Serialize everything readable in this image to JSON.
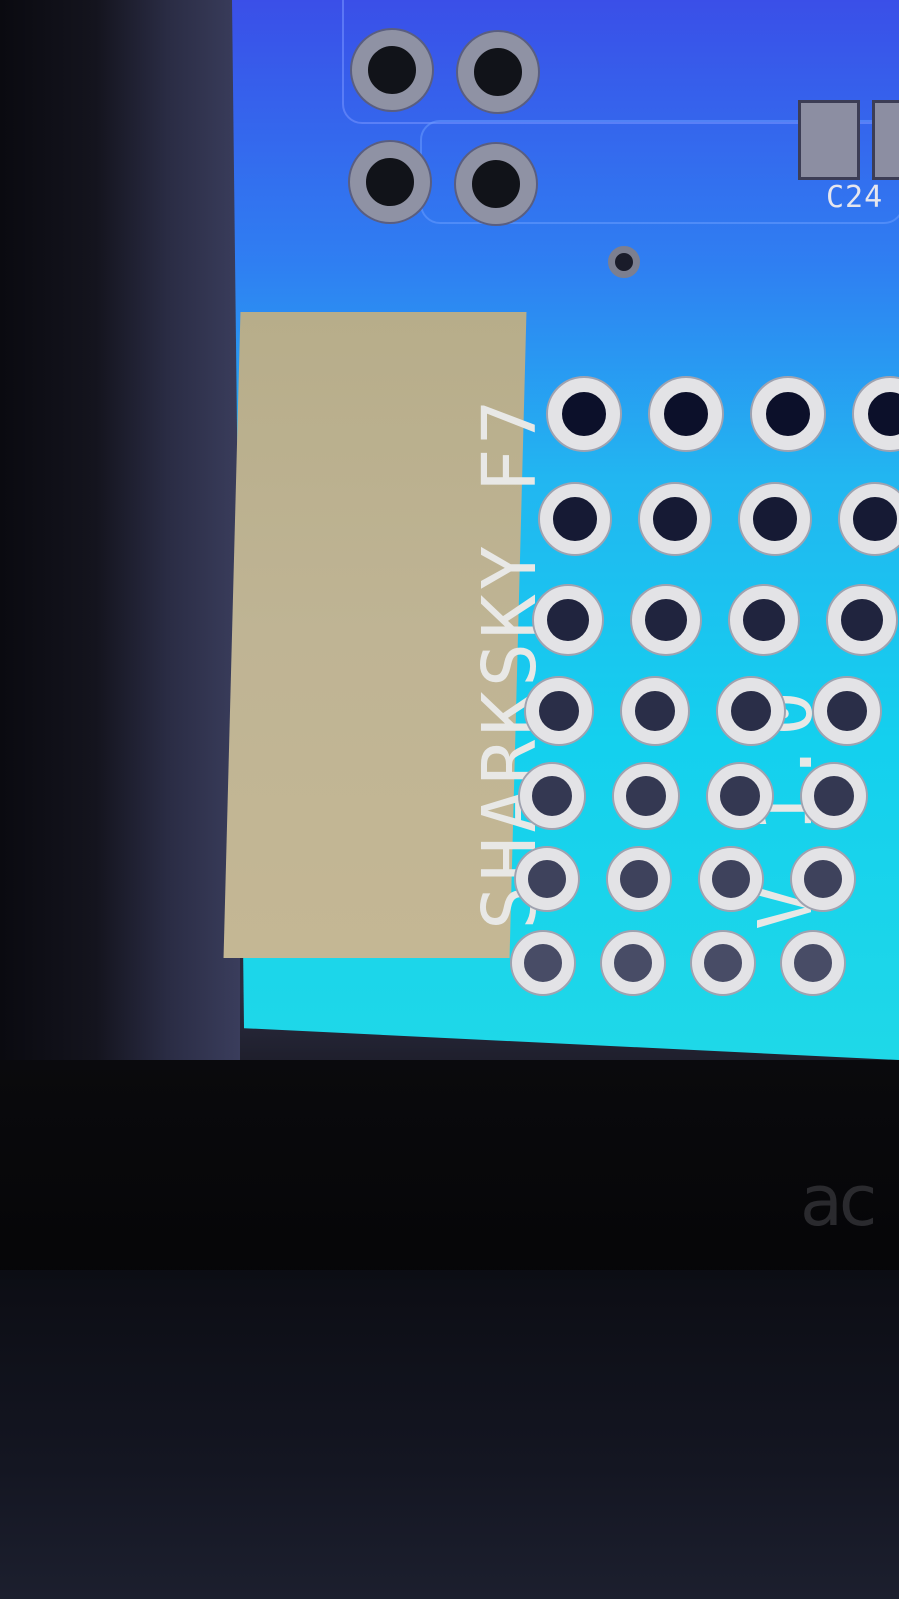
{
  "silkscreen": {
    "line1": "SHARKSKY F7",
    "line2": "V 1.0"
  },
  "component_ref": "C24",
  "brand_fragment": "ac",
  "colors": {
    "board_top": "#3a4fe8",
    "board_bottom": "#1fd8e8",
    "silk_label_bg": "#bfb494",
    "pad_white": "#e3e3e6",
    "pad_gray": "#8f92a4"
  },
  "icons": [
    "through-hole-pad-icon",
    "via-icon",
    "smd-pad-icon"
  ]
}
